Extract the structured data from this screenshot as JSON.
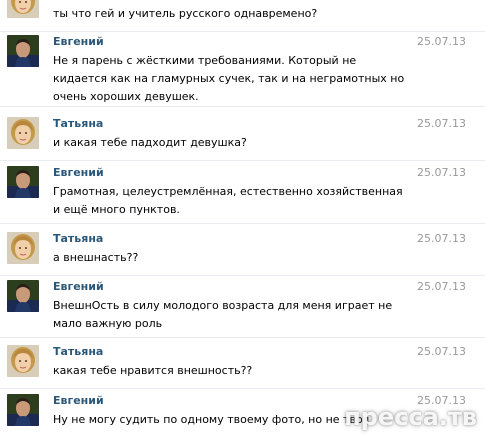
{
  "messages": [
    {
      "author": "",
      "avatar": "female-avatar",
      "date": "",
      "text": "ты что гей и учитель русского однавремено?"
    },
    {
      "author": "Евгений",
      "avatar": "male-avatar",
      "date": "25.07.13",
      "text": "Не я парень с жёсткими требованиями. Который не кидается как на гламурных сучек, так и на неграмотных но очень хороших девушек."
    },
    {
      "author": "Татьяна",
      "avatar": "female-avatar",
      "date": "25.07.13",
      "text": "и какая тебе падходит девушка?"
    },
    {
      "author": "Евгений",
      "avatar": "male-avatar",
      "date": "25.07.13",
      "text": "Грамотная, целеустремлённая, естественно хозяйственная и ещё много пунктов."
    },
    {
      "author": "Татьяна",
      "avatar": "female-avatar",
      "date": "25.07.13",
      "text": "а внешнасть??"
    },
    {
      "author": "Евгений",
      "avatar": "male-avatar",
      "date": "25.07.13",
      "text": "ВнешнОсть в силу молодого возраста для меня играет не мало важную роль"
    },
    {
      "author": "Татьяна",
      "avatar": "female-avatar",
      "date": "25.07.13",
      "text": "какая тебе нравится внешность??"
    },
    {
      "author": "Евгений",
      "avatar": "male-avatar",
      "date": "25.07.13",
      "text": "Ну не могу судить по одному твоему фото, но не твоя"
    }
  ],
  "watermark": "пресса.тв",
  "colors": {
    "author": "#2b587a",
    "date": "#999999",
    "text": "#000000",
    "divider": "#e9edf2"
  }
}
